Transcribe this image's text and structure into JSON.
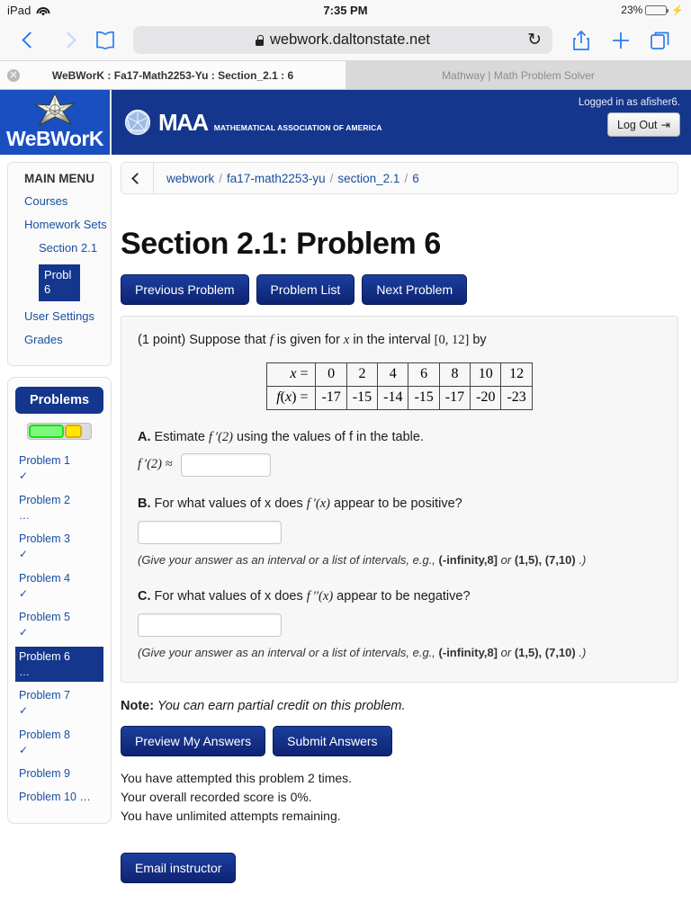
{
  "status_bar": {
    "device": "iPad",
    "wifi_icon": "wifi-icon",
    "time": "7:35 PM",
    "battery_percent": "23%",
    "battery_level": 23,
    "charging_icon": "lightning-bolt-icon"
  },
  "browser": {
    "back_icon": "chevron-left-icon",
    "forward_icon": "chevron-right-icon",
    "bookmarks_icon": "open-book-icon",
    "lock_icon": "padlock-icon",
    "url": "webwork.daltonstate.net",
    "reload_icon": "reload-icon",
    "share_icon": "share-upload-icon",
    "new_tab_icon": "plus-icon",
    "tabs_icon": "tab-overview-icon",
    "tabs": [
      {
        "title": "WeBWorK : Fa17-Math2253-Yu : Section_2.1 : 6",
        "active": true,
        "close_icon": "close-icon",
        "close_label": "✕"
      },
      {
        "title": "Mathway | Math Problem Solver",
        "active": false
      }
    ]
  },
  "header": {
    "webwork_logo_text": "WeBWorK",
    "webwork_star_icon": "webwork-star-icon",
    "maa_ball_icon": "maa-icosahedron-icon",
    "maa_abbrev": "MAA",
    "maa_full": "MATHEMATICAL ASSOCIATION OF AMERICA",
    "logged_in_text": "Logged in as afisher6.",
    "logout_label": "Log Out",
    "logout_icon": "logout-arrow-icon",
    "bar_color": "#14368c"
  },
  "sidebar": {
    "menu_title": "MAIN MENU",
    "items": [
      {
        "label": "Courses",
        "level": 0,
        "active": false
      },
      {
        "label": "Homework Sets",
        "level": 0,
        "active": false
      },
      {
        "label": "Section 2.1",
        "level": 1,
        "active": false
      },
      {
        "label": "Probl 6",
        "level": 2,
        "active": true
      },
      {
        "label": "User Settings",
        "level": 0,
        "active": false
      },
      {
        "label": "Grades",
        "level": 0,
        "active": false
      }
    ],
    "problems_panel": {
      "header": "Problems",
      "progress": {
        "green_pct": 58,
        "yellow_pct": 27,
        "green_color": "#7dfa7d",
        "yellow_color": "#ffe800"
      },
      "items": [
        {
          "label": "Problem 1",
          "mark": "✓",
          "active": false
        },
        {
          "label": "Problem 2",
          "mark": "…",
          "active": false
        },
        {
          "label": "Problem 3",
          "mark": "✓",
          "active": false
        },
        {
          "label": "Problem 4",
          "mark": "✓",
          "active": false
        },
        {
          "label": "Problem 5",
          "mark": "✓",
          "active": false
        },
        {
          "label": "Problem 6",
          "mark": "…",
          "active": true
        },
        {
          "label": "Problem 7",
          "mark": "✓",
          "active": false
        },
        {
          "label": "Problem 8",
          "mark": "✓",
          "active": false
        },
        {
          "label": "Problem 9",
          "mark": "",
          "active": false
        },
        {
          "label": "Problem 10 …",
          "mark": "",
          "active": false
        }
      ]
    }
  },
  "breadcrumb": {
    "back_icon": "chevron-left-icon",
    "parts": [
      "webwork",
      "fa17-math2253-yu",
      "section_2.1",
      "6"
    ],
    "separator": "/"
  },
  "main": {
    "page_title": "Section 2.1: Problem 6",
    "nav_buttons": [
      {
        "label": "Previous Problem"
      },
      {
        "label": "Problem List"
      },
      {
        "label": "Next Problem"
      }
    ],
    "statement": {
      "points": "(1 point)",
      "text_before_f": " Suppose that ",
      "f_symbol": "f",
      "text_mid": " is given for ",
      "x_symbol": "x",
      "text_after": " in the interval ",
      "interval": "[0, 12]",
      "text_end": " by"
    },
    "table": {
      "row1_label": "x =",
      "row2_label": "f(x) =",
      "x_values": [
        "0",
        "2",
        "4",
        "6",
        "8",
        "10",
        "12"
      ],
      "f_values": [
        "-17",
        "-15",
        "-14",
        "-15",
        "-17",
        "-20",
        "-23"
      ]
    },
    "parts": [
      {
        "letter": "A.",
        "prompt_pre": " Estimate ",
        "expr": "f ′(2)",
        "prompt_post": " using the values of f in the table.",
        "answer_prefix": "f ′(2) ≈",
        "input_value": "",
        "hint": ""
      },
      {
        "letter": "B.",
        "prompt_pre": " For what values of x does ",
        "expr": "f ′(x)",
        "prompt_post": " appear to be positive?",
        "answer_prefix": "",
        "input_value": "",
        "hint_pre": "(Give your answer as an interval or a list of intervals, e.g., ",
        "hint_b1": "(-infinity,8]",
        "hint_or": " or ",
        "hint_b2": "(1,5), (7,10)",
        "hint_end": " .)"
      },
      {
        "letter": "C.",
        "prompt_pre": " For what values of x does ",
        "expr": "f ′′(x)",
        "prompt_post": " appear to be negative?",
        "answer_prefix": "",
        "input_value": "",
        "hint_pre": "(Give your answer as an interval or a list of intervals, e.g., ",
        "hint_b1": "(-infinity,8]",
        "hint_or": " or ",
        "hint_b2": "(1,5), (7,10)",
        "hint_end": " .)"
      }
    ],
    "note_label": "Note:",
    "note_text": " You can earn partial credit on this problem.",
    "submit_buttons": [
      {
        "label": "Preview My Answers"
      },
      {
        "label": "Submit Answers"
      }
    ],
    "status_lines": [
      "You have attempted this problem 2 times.",
      "Your overall recorded score is 0%.",
      "You have unlimited attempts remaining."
    ],
    "email_button": "Email instructor"
  }
}
